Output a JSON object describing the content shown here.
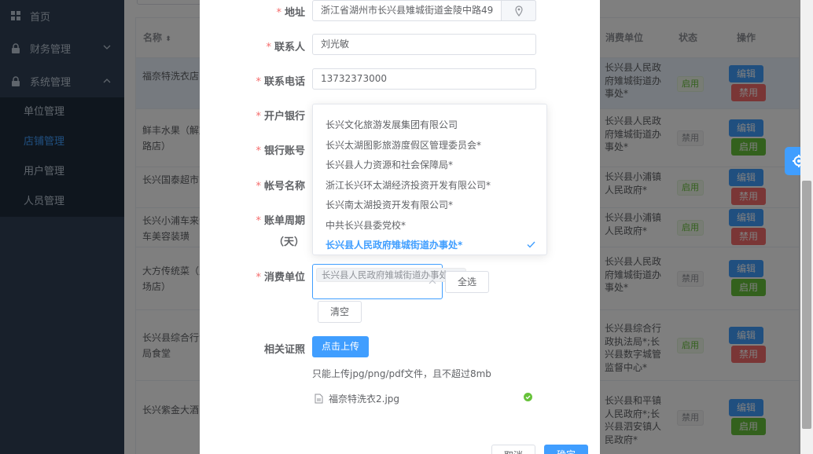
{
  "sidebar": {
    "home": "首页",
    "finance": "财务管理",
    "system": "系统管理",
    "sub": [
      "单位管理",
      "店铺管理",
      "用户管理",
      "人员管理"
    ]
  },
  "table": {
    "headers": {
      "name": "名称",
      "unit": "消费单位",
      "status": "状态",
      "ops": "操作"
    },
    "rows": [
      {
        "name": "福奈特洗衣店",
        "unit": "长兴县人民政府雉城街道办事处*",
        "status": "启用",
        "status_on": true,
        "edit": "编辑",
        "toggle": "禁用"
      },
      {
        "name": "鲜丰水果（解放路店）",
        "unit": "长兴县人民政府雉城街道办事处*",
        "status": "禁用",
        "status_on": false,
        "edit": "编辑",
        "toggle": "启用"
      },
      {
        "name": "长兴国泰超市",
        "unit": "长兴县小浦镇人民政府*",
        "status": "启用",
        "status_on": true,
        "edit": "编辑",
        "toggle": "禁用"
      },
      {
        "name": "长兴小浦车来汽车美容装璜",
        "unit": "长兴县小浦镇人民政府*",
        "status": "启用",
        "status_on": true,
        "edit": "编辑",
        "toggle": "禁用"
      },
      {
        "name": "大方传统菜（广场店）",
        "unit": "长兴县人民政府雉城街道办事处*",
        "status": "禁用",
        "status_on": false,
        "edit": "编辑",
        "toggle": "启用"
      },
      {
        "name": "长兴县综合行法局食堂",
        "unit": "长兴县综合行政执法局*;长兴县数字城管监督中心*",
        "status": "启用",
        "status_on": true,
        "edit": "编辑",
        "toggle": "禁用"
      },
      {
        "name": "长兴紫金大酒",
        "unit": "长兴县和平镇人民政府*;长兴县泗安镇人民政府*",
        "status": "禁用",
        "status_on": false,
        "edit": "编辑",
        "toggle": "启用"
      }
    ]
  },
  "form": {
    "address_label": "地址",
    "address_value": "浙江省湖州市长兴县雉城街道金陵中路49",
    "contact_label": "联系人",
    "contact_value": "刘光敏",
    "phone_label": "联系电话",
    "phone_value": "13732373000",
    "bank_label": "开户银行",
    "account_label": "银行账号",
    "account_name_label": "帐号名称",
    "period_label": "账单周期",
    "period_unit": "（天）",
    "consumer_label": "消费单位",
    "selected_chip": "长兴县人民政府雉城街道办事处*",
    "select_all": "全选",
    "clear": "清空",
    "cert_label": "相关证照",
    "upload_btn": "点击上传",
    "upload_tip": "只能上传jpg/png/pdf文件，且不超过8mb",
    "file_name": "福奈特洗衣2.jpg",
    "cancel": "取消",
    "confirm": "确定"
  },
  "dropdown": {
    "items": [
      "长兴文化旅游发展集团有限公司",
      "长兴太湖图影旅游度假区管理委员会*",
      "长兴县人力资源和社会保障局*",
      "浙江长兴环太湖经济投资开发有限公司*",
      "长兴南太湖投资开发有限公司*",
      "中共长兴县委党校*",
      "长兴县人民政府雉城街道办事处*"
    ],
    "selected_index": 6
  },
  "colors": {
    "primary": "#409eff",
    "danger": "#f56c6c",
    "success": "#67c23a",
    "sidebar": "#304156"
  }
}
